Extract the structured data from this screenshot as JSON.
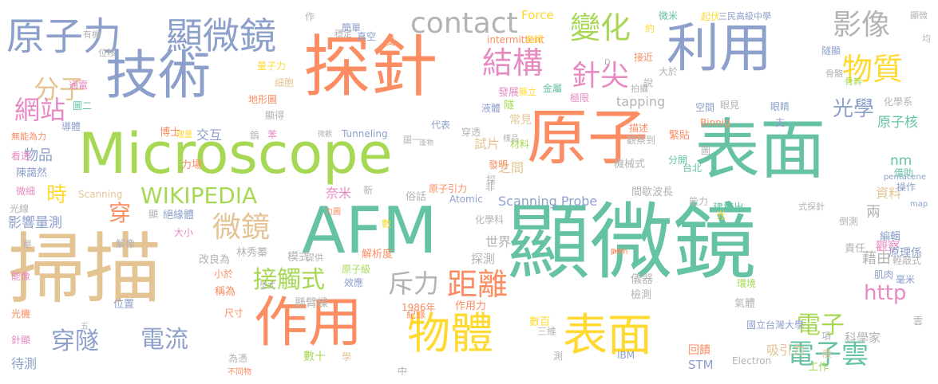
{
  "colors": {
    "blue": "#8da0cb",
    "orange": "#fc8d62",
    "green": "#66c2a5",
    "lime": "#a6d854",
    "pink": "#e78ac3",
    "yellow": "#ffd92f",
    "tan": "#e5c494",
    "gray": "#b3b3b3"
  },
  "words": [
    {
      "text": "顯微鏡"
    },
    {
      "text": "表面"
    },
    {
      "text": "原子"
    },
    {
      "text": "探針"
    },
    {
      "text": "掃描"
    },
    {
      "text": "Microscope"
    },
    {
      "text": "AFM"
    },
    {
      "text": "技術"
    },
    {
      "text": "利用"
    },
    {
      "text": "作用"
    },
    {
      "text": "物體"
    },
    {
      "text": "表面"
    },
    {
      "text": "原子力"
    },
    {
      "text": "顯微鏡"
    },
    {
      "text": "contact"
    },
    {
      "text": "變化"
    },
    {
      "text": "結構"
    },
    {
      "text": "針尖"
    },
    {
      "text": "物質"
    },
    {
      "text": "影像"
    },
    {
      "text": "分子"
    },
    {
      "text": "網站"
    },
    {
      "text": "光學"
    },
    {
      "text": "WIKIPEDIA"
    },
    {
      "text": "微鏡"
    },
    {
      "text": "接觸式"
    },
    {
      "text": "斥力"
    },
    {
      "text": "距離"
    },
    {
      "text": "http"
    },
    {
      "text": "電子"
    },
    {
      "text": "電子雲"
    },
    {
      "text": "穿隧"
    },
    {
      "text": "電流"
    },
    {
      "text": "時"
    },
    {
      "text": "穿"
    },
    {
      "text": "影響量測"
    },
    {
      "text": "Force"
    },
    {
      "text": "intermittent"
    },
    {
      "text": "tapping"
    },
    {
      "text": "Scanning Probe"
    },
    {
      "text": "原子核"
    },
    {
      "text": "nm"
    },
    {
      "text": "奈米"
    },
    {
      "text": "資料"
    },
    {
      "text": "兩"
    },
    {
      "text": "藉由"
    },
    {
      "text": "觀察"
    },
    {
      "text": "吸引力"
    },
    {
      "text": "科學家"
    },
    {
      "text": "Tunneling"
    },
    {
      "text": "Binnig"
    },
    {
      "text": "Atomic"
    },
    {
      "text": "Scanning"
    },
    {
      "text": "Electron"
    },
    {
      "text": "STM"
    },
    {
      "text": "pentacene"
    },
    {
      "text": "1986年"
    },
    {
      "text": "IBM"
    },
    {
      "text": "國立台灣大學"
    },
    {
      "text": "三民高級中學"
    },
    {
      "text": "試片"
    },
    {
      "text": "發明"
    },
    {
      "text": "之間"
    },
    {
      "text": "模式"
    },
    {
      "text": "懸臂樑"
    },
    {
      "text": "林秀蓁"
    },
    {
      "text": "陳藹然"
    },
    {
      "text": "世界"
    },
    {
      "text": "探測"
    },
    {
      "text": "物品"
    },
    {
      "text": "交互"
    },
    {
      "text": "博士"
    },
    {
      "text": "台北"
    },
    {
      "text": "機械式"
    },
    {
      "text": "觀察到"
    },
    {
      "text": "描述"
    },
    {
      "text": "緊貼"
    },
    {
      "text": "分開"
    },
    {
      "text": "能力"
    },
    {
      "text": "儀器"
    },
    {
      "text": "檢測"
    },
    {
      "text": "建構出"
    },
    {
      "text": "原理係"
    },
    {
      "text": "輕敲式"
    },
    {
      "text": "編輯"
    },
    {
      "text": "責任"
    },
    {
      "text": "肌肉"
    },
    {
      "text": "毫米"
    },
    {
      "text": "氣體"
    },
    {
      "text": "回饋"
    },
    {
      "text": "環境"
    },
    {
      "text": "工作"
    },
    {
      "text": "數十"
    },
    {
      "text": "數百"
    },
    {
      "text": "三維"
    },
    {
      "text": "作用力"
    },
    {
      "text": "紀錄"
    },
    {
      "text": "效應"
    },
    {
      "text": "原子級"
    },
    {
      "text": "原子引力"
    },
    {
      "text": "解析度"
    },
    {
      "text": "提供"
    },
    {
      "text": "改良為"
    },
    {
      "text": "稱為"
    },
    {
      "text": "位置"
    },
    {
      "text": "解像"
    },
    {
      "text": "大小"
    },
    {
      "text": "絕緣體"
    },
    {
      "text": "力場"
    },
    {
      "text": "微細"
    },
    {
      "text": "光線"
    },
    {
      "text": "看透"
    },
    {
      "text": "無能為力"
    },
    {
      "text": "導體"
    },
    {
      "text": "圖二"
    },
    {
      "text": "通電"
    },
    {
      "text": "細胞"
    },
    {
      "text": "地形圖"
    },
    {
      "text": "顯得"
    },
    {
      "text": "量子力"
    },
    {
      "text": "位移"
    },
    {
      "text": "有機"
    },
    {
      "text": "簡單"
    },
    {
      "text": "穩定"
    },
    {
      "text": "真空"
    },
    {
      "text": "受"
    },
    {
      "text": "老師"
    },
    {
      "text": "發展"
    },
    {
      "text": "縣立"
    },
    {
      "text": "金屬"
    },
    {
      "text": "極限"
    },
    {
      "text": "液體"
    },
    {
      "text": "隧"
    },
    {
      "text": "常見"
    },
    {
      "text": "代表"
    },
    {
      "text": "穿透"
    },
    {
      "text": "蓬物"
    },
    {
      "text": "微觀"
    },
    {
      "text": "材料"
    },
    {
      "text": "圖一"
    },
    {
      "text": "空間"
    },
    {
      "text": "眼見"
    },
    {
      "text": "眼睛"
    },
    {
      "text": "化學系"
    },
    {
      "text": "化學科"
    },
    {
      "text": "拍攝"
    },
    {
      "text": "接近"
    },
    {
      "text": "說"
    },
    {
      "text": "大於"
    },
    {
      "text": "約"
    },
    {
      "text": "微米"
    },
    {
      "text": "起伏"
    },
    {
      "text": "顯微"
    },
    {
      "text": "均"
    },
    {
      "text": "骨幹"
    },
    {
      "text": "骨骼"
    },
    {
      "text": "隧顯"
    },
    {
      "text": "借助"
    },
    {
      "text": "操作"
    },
    {
      "text": "式探針"
    },
    {
      "text": "間歇波長"
    },
    {
      "text": "俗話"
    },
    {
      "text": "新"
    },
    {
      "text": "非"
    },
    {
      "text": "數"
    },
    {
      "text": "力圖"
    },
    {
      "text": "pm"
    },
    {
      "text": "mm"
    },
    {
      "text": "map"
    },
    {
      "text": "倒測"
    },
    {
      "text": "為憑"
    },
    {
      "text": "不同物"
    },
    {
      "text": "學"
    },
    {
      "text": "中"
    },
    {
      "text": "尺寸"
    },
    {
      "text": "待測"
    },
    {
      "text": "針顯"
    },
    {
      "text": "光機"
    },
    {
      "text": "能像"
    },
    {
      "text": "單"
    },
    {
      "text": "五"
    },
    {
      "text": "小於"
    },
    {
      "text": "型式"
    },
    {
      "text": "光"
    },
    {
      "text": "支"
    },
    {
      "text": "雲"
    },
    {
      "text": "般"
    },
    {
      "text": "項"
    },
    {
      "text": "鎢"
    },
    {
      "text": "理量"
    },
    {
      "text": "作"
    },
    {
      "text": "苯"
    },
    {
      "text": "樣品"
    },
    {
      "text": "測"
    },
    {
      "text": "探"
    },
    {
      "text": "顯"
    },
    {
      "text": "圖"
    },
    {
      "text": "D"
    }
  ]
}
